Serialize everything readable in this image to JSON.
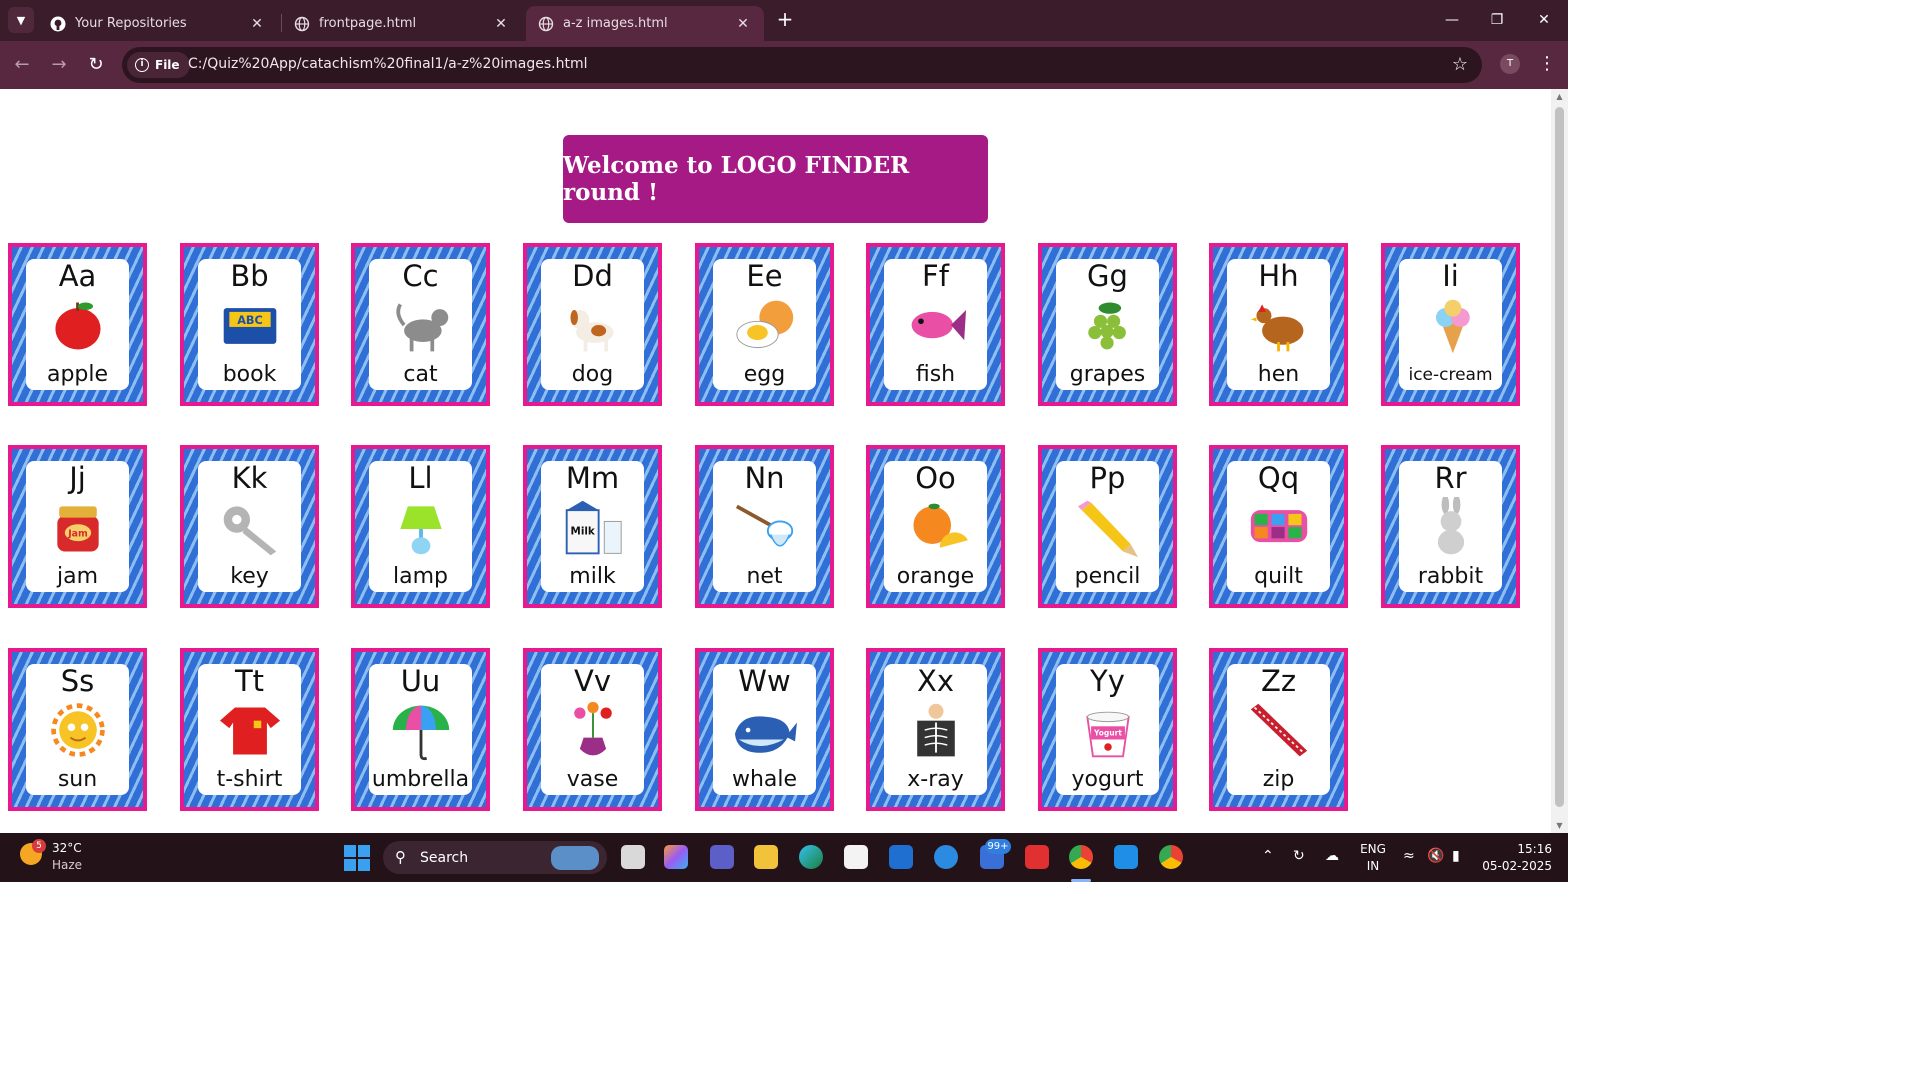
{
  "browser": {
    "tabs": [
      {
        "title": "Your Repositories",
        "icon": "github-icon",
        "active": false
      },
      {
        "title": "frontpage.html",
        "icon": "globe-icon",
        "active": false
      },
      {
        "title": "a-z images.html",
        "icon": "globe-icon",
        "active": true
      }
    ],
    "scheme_chip": "File",
    "url": "C:/Quiz%20App/catachism%20final1/a-z%20images.html",
    "profile_initial": "T"
  },
  "page": {
    "banner": "Welcome to LOGO FINDER round !",
    "cards": [
      {
        "letters": "Aa",
        "word": "apple",
        "picture": "apple"
      },
      {
        "letters": "Bb",
        "word": "book",
        "picture": "book",
        "pic_text": "ABC"
      },
      {
        "letters": "Cc",
        "word": "cat",
        "picture": "cat"
      },
      {
        "letters": "Dd",
        "word": "dog",
        "picture": "dog"
      },
      {
        "letters": "Ee",
        "word": "egg",
        "picture": "egg"
      },
      {
        "letters": "Ff",
        "word": "fish",
        "picture": "fish"
      },
      {
        "letters": "Gg",
        "word": "grapes",
        "picture": "grapes"
      },
      {
        "letters": "Hh",
        "word": "hen",
        "picture": "hen"
      },
      {
        "letters": "Ii",
        "word": "ice-cream",
        "picture": "ice-cream"
      },
      {
        "letters": "Jj",
        "word": "jam",
        "picture": "jam",
        "pic_text": "Jam"
      },
      {
        "letters": "Kk",
        "word": "key",
        "picture": "key"
      },
      {
        "letters": "Ll",
        "word": "lamp",
        "picture": "lamp"
      },
      {
        "letters": "Mm",
        "word": "milk",
        "picture": "milk",
        "pic_text": "Milk"
      },
      {
        "letters": "Nn",
        "word": "net",
        "picture": "net"
      },
      {
        "letters": "Oo",
        "word": "orange",
        "picture": "orange"
      },
      {
        "letters": "Pp",
        "word": "pencil",
        "picture": "pencil"
      },
      {
        "letters": "Qq",
        "word": "quilt",
        "picture": "quilt"
      },
      {
        "letters": "Rr",
        "word": "rabbit",
        "picture": "rabbit"
      },
      {
        "letters": "Ss",
        "word": "sun",
        "picture": "sun"
      },
      {
        "letters": "Tt",
        "word": "t-shirt",
        "picture": "t-shirt"
      },
      {
        "letters": "Uu",
        "word": "umbrella",
        "picture": "umbrella"
      },
      {
        "letters": "Vv",
        "word": "vase",
        "picture": "vase"
      },
      {
        "letters": "Ww",
        "word": "whale",
        "picture": "whale"
      },
      {
        "letters": "Xx",
        "word": "x-ray",
        "picture": "x-ray"
      },
      {
        "letters": "Yy",
        "word": "yogurt",
        "picture": "yogurt",
        "pic_text": "Yogurt"
      },
      {
        "letters": "Zz",
        "word": "zip",
        "picture": "zip"
      }
    ]
  },
  "taskbar": {
    "weather_badge": "5",
    "weather_temp": "32°C",
    "weather_condition": "Haze",
    "search_label": "Search",
    "notification_badge": "99+",
    "chrome_badge": "T",
    "language": "ENG",
    "region": "IN",
    "time": "15:16",
    "date": "05-02-2025"
  },
  "colors": {
    "tabstrip": "#3a1c2b",
    "toolbar": "#57283f",
    "banner": "#a61a86",
    "card_border": "#e6198f",
    "card_stripe_dark": "#2f6fd6",
    "card_stripe_light": "#8ebdf2"
  }
}
